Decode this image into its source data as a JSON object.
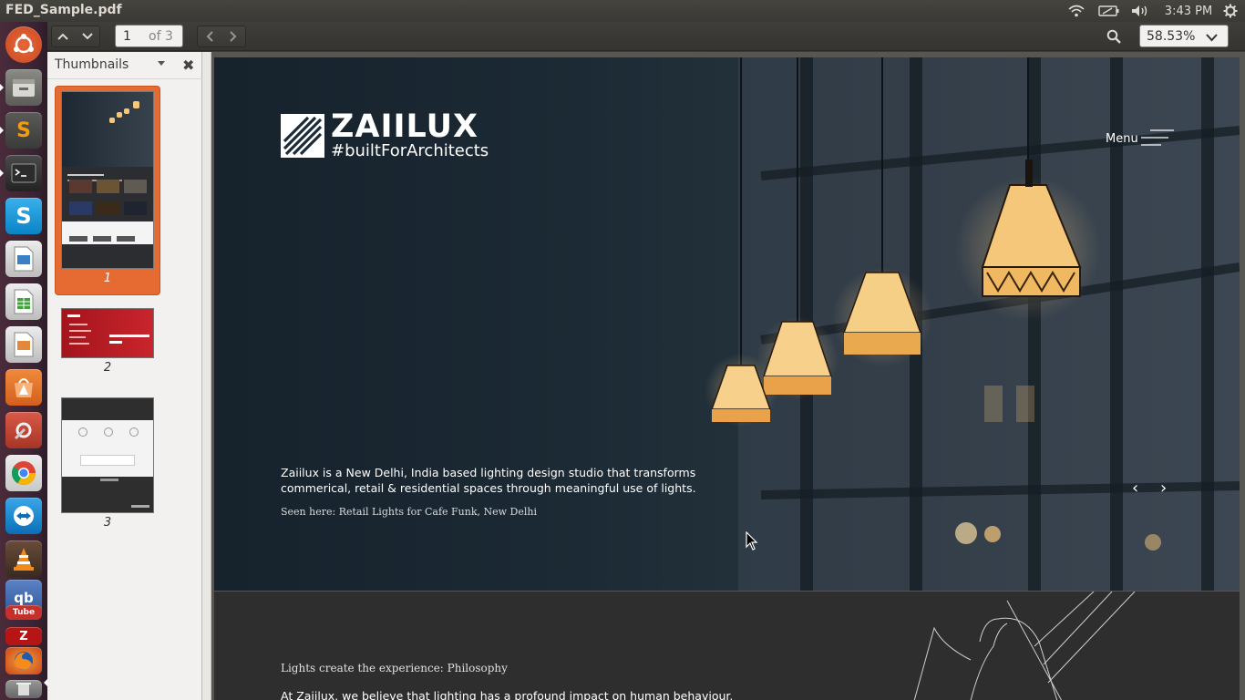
{
  "window": {
    "title": "FED_Sample.pdf"
  },
  "panel": {
    "time": "3:43 PM"
  },
  "launcher": {
    "apps": [
      "ubuntu-dash",
      "files",
      "sublime-text",
      "terminal",
      "skype",
      "libreoffice-impress",
      "libreoffice-calc",
      "libreoffice-draw",
      "software-center",
      "system-settings",
      "chrome",
      "teamviewer",
      "vlc",
      "qbittorrent",
      "youtube",
      "filezilla",
      "firefox",
      "trash"
    ],
    "sublime_letter": "S",
    "youtube_label": "Tube"
  },
  "toolbar": {
    "page_current": "1",
    "page_total": "of 3",
    "zoom": "58.53%"
  },
  "sidebar": {
    "title": "Thumbnails",
    "close_glyph": "✖",
    "pages": [
      "1",
      "2",
      "3"
    ],
    "selected_page": "1"
  },
  "document": {
    "brand": "ZAIILUX",
    "tagline": "#builtForArchitects",
    "menu_label": "Menu",
    "intro": "Zaiilux is a New Delhi, India based lighting design studio that transforms commerical, retail & residential spaces through meaningful use of lights.",
    "caption": "Seen here: Retail Lights for Cafe Funk, New Delhi",
    "prev_arrow": "‹",
    "next_arrow": "›",
    "section_title": "Lights create the experience: Philosophy",
    "section_text": "At Zaiilux, we believe that lighting has a profound impact on human behaviour."
  },
  "colors": {
    "selection": "#e66b32",
    "panel": "#3c3b37",
    "hero_dark": "#1c2a35",
    "lamp": "#f5c77a"
  }
}
